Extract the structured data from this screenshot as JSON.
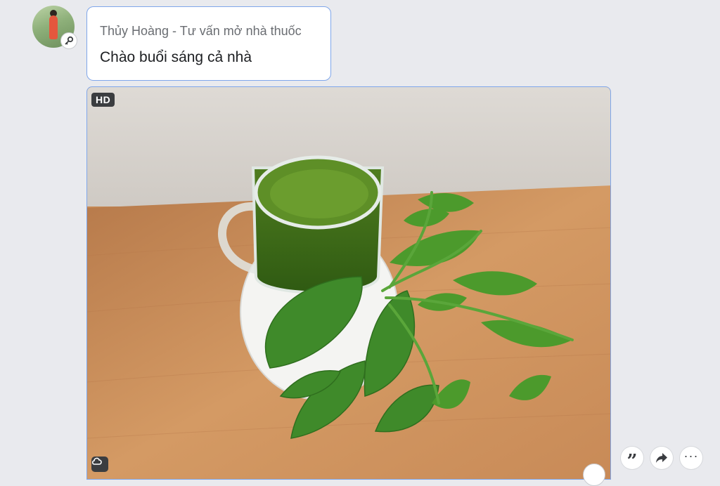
{
  "sender": {
    "name": "Thủy Hoàng - Tư vấn mở nhà thuốc",
    "avatar_icon": "profile-avatar",
    "badge_icon": "key-icon"
  },
  "message": {
    "text": "Chào buổi sáng cả nhà"
  },
  "photo": {
    "quality_badge": "HD",
    "cloud_icon": "cloud-icon",
    "subject": "green-juice-with-vegetables"
  },
  "actions": [
    {
      "name": "quote",
      "icon": "quote-icon"
    },
    {
      "name": "forward",
      "icon": "forward-icon"
    },
    {
      "name": "more",
      "icon": "more-icon"
    }
  ],
  "colors": {
    "accent_border": "#7fa6ea",
    "background": "#e9eaee"
  }
}
